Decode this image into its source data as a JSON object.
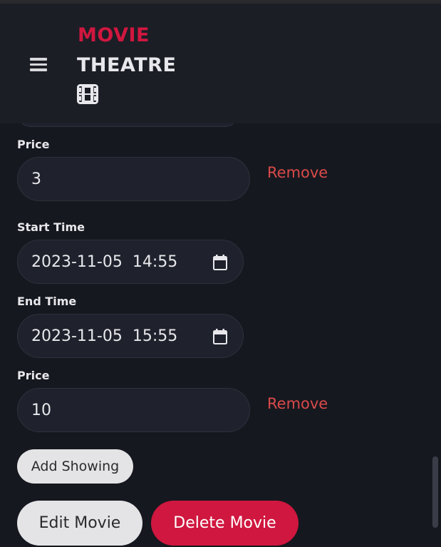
{
  "header": {
    "brand_line1": "MOVIE",
    "brand_line2": "THEATRE",
    "brand_icon": "film-icon",
    "menu_icon": "hamburger-menu-icon"
  },
  "showings": [
    {
      "price_label": "Price",
      "price_value": "3",
      "remove_label": "Remove"
    },
    {
      "start_label": "Start Time",
      "start_value": "2023-11-05  14:55",
      "end_label": "End Time",
      "end_value": "2023-11-05  15:55",
      "price_label": "Price",
      "price_value": "10",
      "remove_label": "Remove"
    }
  ],
  "actions": {
    "add_showing": "Add Showing",
    "edit_movie": "Edit Movie",
    "delete_movie": "Delete Movie"
  },
  "colors": {
    "brand_accent": "#d0173f",
    "remove_text": "#d94a4a",
    "background": "#16181f",
    "header_bg": "#1c1e26"
  }
}
